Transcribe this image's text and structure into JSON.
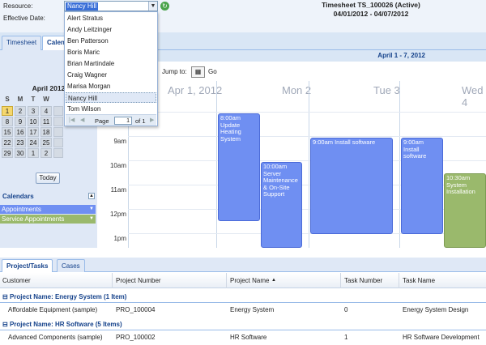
{
  "header": {
    "resource_label": "Resource:",
    "effective_date_label": "Effective Date:",
    "resource_value": "Nancy Hill",
    "timesheet_title": "Timesheet TS_100026 (Active)",
    "timesheet_dates": "04/01/2012 - 04/07/2012"
  },
  "tabs": [
    {
      "label": "Timesheet"
    },
    {
      "label": "Calen"
    }
  ],
  "resource_dropdown": {
    "items": [
      "Alert Stratus",
      "Andy Leitzinger",
      "Ben Patterson",
      "Boris Maric",
      "Brian Martindale",
      "Craig Wagner",
      "Marisa Morgan",
      "Nancy Hill",
      "Tom Wilson"
    ],
    "selected": "Nancy Hill",
    "pager": {
      "page_label": "Page",
      "page_value": "1",
      "of_label": "of 1"
    }
  },
  "mini_calendar": {
    "month_label": "April 2012",
    "weekday_headers": [
      "S",
      "M",
      "T",
      "W"
    ],
    "weeks": [
      [
        "1",
        "2",
        "3",
        "4"
      ],
      [
        "8",
        "9",
        "10",
        "11"
      ],
      [
        "15",
        "16",
        "17",
        "18"
      ],
      [
        "22",
        "23",
        "24",
        "25"
      ],
      [
        "29",
        "30",
        "1",
        "2"
      ]
    ],
    "today_label": "Today"
  },
  "calendars_panel": {
    "title": "Calendars",
    "items": [
      {
        "label": "Appointments",
        "color": "#6f8ff2"
      },
      {
        "label": "Service Appointments",
        "color": "#9ab96c"
      }
    ]
  },
  "calendar": {
    "week_range": "April 1 - 7, 2012",
    "jump_to_label": "Jump to:",
    "go_label": "Go",
    "days": [
      "Apr 1, 2012",
      "Mon 2",
      "Tue 3",
      "Wed 4"
    ],
    "times": [
      "9am",
      "10am",
      "11am",
      "12pm",
      "1pm"
    ],
    "events": [
      {
        "text": "8:00am Update Heating System",
        "color": "#6f8ff2"
      },
      {
        "text": "10:00am Server Maintenance & On-Site Support",
        "color": "#6f8ff2"
      },
      {
        "text": "9:00am Install software",
        "color": "#6f8ff2"
      },
      {
        "text": "9:00am Install software",
        "color": "#6f8ff2"
      },
      {
        "text": "10:30am System Installation",
        "color": "#9ab96c"
      }
    ]
  },
  "bottom_tabs": [
    {
      "label": "Project/Tasks"
    },
    {
      "label": "Cases"
    }
  ],
  "grid": {
    "columns": [
      "Customer",
      "Project Number",
      "Project Name",
      "Task Number",
      "Task Name"
    ],
    "groups": [
      {
        "title": "Project Name: Energy System (1 Item)",
        "rows": [
          [
            "Affordable Equipment (sample)",
            "PRO_100004",
            "Energy System",
            "0",
            "Energy System Design"
          ]
        ]
      },
      {
        "title": "Project Name: HR Software (5 Items)",
        "rows": [
          [
            "Advanced Components (sample)",
            "PRO_100002",
            "HR Software",
            "1",
            "HR Software Development"
          ]
        ]
      }
    ]
  }
}
